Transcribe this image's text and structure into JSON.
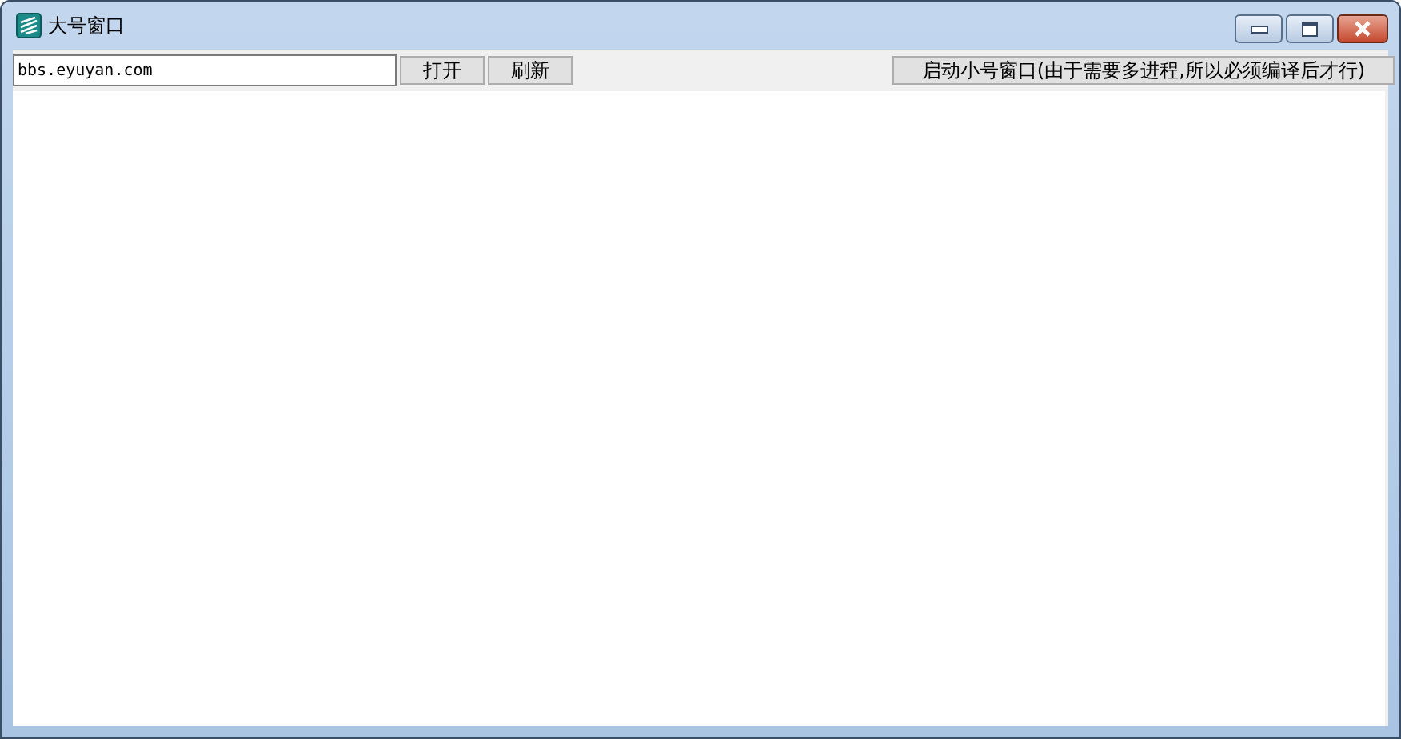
{
  "window": {
    "title": "大号窗口"
  },
  "toolbar": {
    "url": {
      "value": "bbs.eyuyan.com"
    },
    "buttons": [
      "打开",
      "刷新"
    ],
    "launch_button": "启动小号窗口(由于需要多进程,所以必须编译后才行)"
  }
}
